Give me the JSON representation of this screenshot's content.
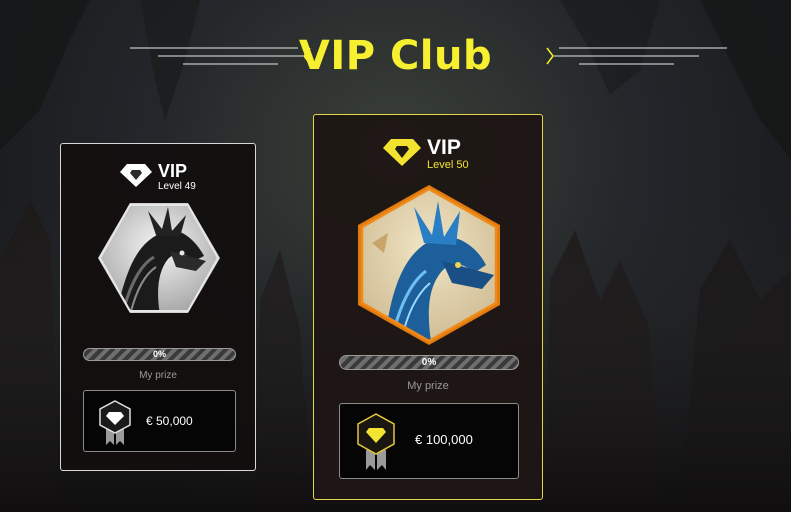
{
  "page": {
    "title": "VIP Club",
    "accent_color": "#f7f030"
  },
  "cards": [
    {
      "vip_label": "VIP",
      "level": "Level 49",
      "progress_text": "0%",
      "progress_fraction": 0,
      "prize_label": "My prize",
      "prize_amount": "€ 50,000",
      "icon": "diamond-icon",
      "theme": "silver"
    },
    {
      "vip_label": "VIP",
      "level": "Level 50",
      "progress_text": "0%",
      "progress_fraction": 0,
      "prize_label": "My prize",
      "prize_amount": "€ 100,000",
      "icon": "diamond-icon",
      "theme": "gold"
    }
  ]
}
